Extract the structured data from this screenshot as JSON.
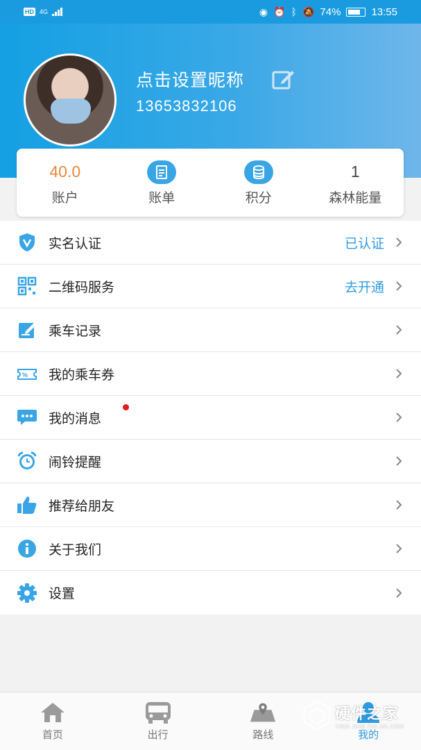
{
  "status_bar": {
    "network_badge": "HD",
    "network_type": "4G",
    "battery": "74%",
    "time": "13:55"
  },
  "profile": {
    "nickname": "点击设置昵称",
    "phone": "13653832106"
  },
  "stats": [
    {
      "value": "40.0",
      "label": "账户"
    },
    {
      "icon": "bill-icon",
      "label": "账单"
    },
    {
      "icon": "coin-stack-icon",
      "label": "积分"
    },
    {
      "value": "1",
      "label": "森林能量"
    }
  ],
  "menu": [
    {
      "label": "实名认证",
      "status": "已认证",
      "icon": "shield-v-icon"
    },
    {
      "label": "二维码服务",
      "status": "去开通",
      "icon": "qr-code-icon"
    },
    {
      "label": "乘车记录",
      "icon": "record-icon"
    },
    {
      "label": "我的乘车券",
      "icon": "ticket-icon"
    },
    {
      "label": "我的消息",
      "icon": "message-icon"
    },
    {
      "label": "闹铃提醒",
      "icon": "alarm-icon"
    },
    {
      "label": "推荐给朋友",
      "icon": "thumbs-up-icon"
    },
    {
      "label": "关于我们",
      "icon": "info-icon"
    },
    {
      "label": "设置",
      "icon": "gear-icon"
    }
  ],
  "nav": [
    {
      "label": "首页",
      "icon": "home-icon"
    },
    {
      "label": "出行",
      "icon": "bus-icon"
    },
    {
      "label": "路线",
      "icon": "map-icon"
    },
    {
      "label": "我的",
      "icon": "user-icon"
    }
  ],
  "watermark": {
    "title": "硬件之家",
    "subtitle": "YING JIAN ZHI JIA.COM"
  },
  "colors": {
    "accent": "#2e9be0",
    "header_start": "#14a0e3",
    "header_end": "#6fb6ea",
    "balance": "#e58a3b",
    "unread_dot": "#e01c1c"
  }
}
